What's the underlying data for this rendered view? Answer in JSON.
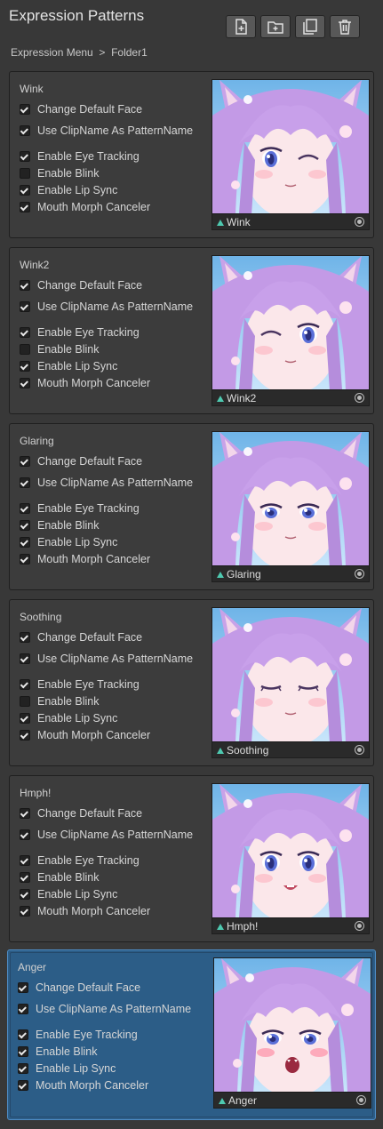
{
  "window": {
    "title": "Expression Patterns"
  },
  "toolbar": {
    "buttons": [
      {
        "name": "add-pattern-button",
        "icon": "new-file-plus-icon"
      },
      {
        "name": "add-folder-button",
        "icon": "folder-plus-icon"
      },
      {
        "name": "copy-button",
        "icon": "copy-icon"
      },
      {
        "name": "delete-button",
        "icon": "trash-icon"
      }
    ]
  },
  "breadcrumb": {
    "root": "Expression Menu",
    "separator": ">",
    "current": "Folder1"
  },
  "option_labels": {
    "change_default_face": "Change Default Face",
    "use_clipname": "Use ClipName As PatternName",
    "eye_tracking": "Enable Eye Tracking",
    "blink": "Enable Blink",
    "lip_sync": "Enable Lip Sync",
    "mouth_canceler": "Mouth Morph Canceler"
  },
  "colors": {
    "accent_selected": "#2c5d87",
    "panel": "#3c3c3c",
    "background": "#383838",
    "clip_icon": "#4ec9b0"
  },
  "patterns": [
    {
      "name": "Wink",
      "clip": "Wink",
      "selected": false,
      "face": "wink-left",
      "options": {
        "change_default_face": true,
        "use_clipname": true,
        "eye_tracking": true,
        "blink": false,
        "lip_sync": true,
        "mouth_canceler": true
      }
    },
    {
      "name": "Wink2",
      "clip": "Wink2",
      "selected": false,
      "face": "wink-right",
      "options": {
        "change_default_face": true,
        "use_clipname": true,
        "eye_tracking": true,
        "blink": false,
        "lip_sync": true,
        "mouth_canceler": true
      }
    },
    {
      "name": "Glaring",
      "clip": "Glaring",
      "selected": false,
      "face": "glaring",
      "options": {
        "change_default_face": true,
        "use_clipname": true,
        "eye_tracking": true,
        "blink": true,
        "lip_sync": true,
        "mouth_canceler": true
      }
    },
    {
      "name": "Soothing",
      "clip": "Soothing",
      "selected": false,
      "face": "closed",
      "options": {
        "change_default_face": true,
        "use_clipname": true,
        "eye_tracking": true,
        "blink": false,
        "lip_sync": true,
        "mouth_canceler": true
      }
    },
    {
      "name": "Hmph!",
      "clip": "Hmph!",
      "selected": false,
      "face": "hmph",
      "options": {
        "change_default_face": true,
        "use_clipname": true,
        "eye_tracking": true,
        "blink": true,
        "lip_sync": true,
        "mouth_canceler": true
      }
    },
    {
      "name": "Anger",
      "clip": "Anger",
      "selected": true,
      "face": "anger",
      "options": {
        "change_default_face": true,
        "use_clipname": true,
        "eye_tracking": true,
        "blink": true,
        "lip_sync": true,
        "mouth_canceler": true
      }
    }
  ]
}
